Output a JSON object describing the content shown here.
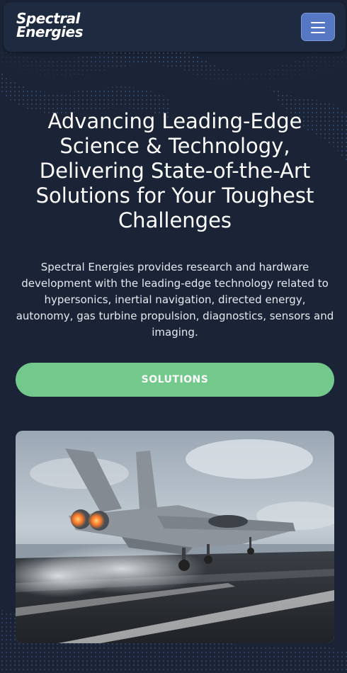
{
  "brand": {
    "line1": "Spectral",
    "line2": "Energies"
  },
  "nav": {
    "menu_icon": "hamburger-menu-icon"
  },
  "hero": {
    "headline": "Advancing Leading-Edge Science & Technology, Delivering State-of-the-Art Solutions for Your Toughest Challenges",
    "description": "Spectral Energies provides research and hardware development with the leading-edge technology related to hypersonics, inertial navigation, directed energy, autonomy, gas turbine propulsion, diagnostics, sensors and imaging.",
    "cta_label": "SOLUTIONS"
  },
  "colors": {
    "background": "#1a2436",
    "navbar": "#1e2a3f",
    "menu_button": "#5577c4",
    "cta": "#72c98b"
  }
}
